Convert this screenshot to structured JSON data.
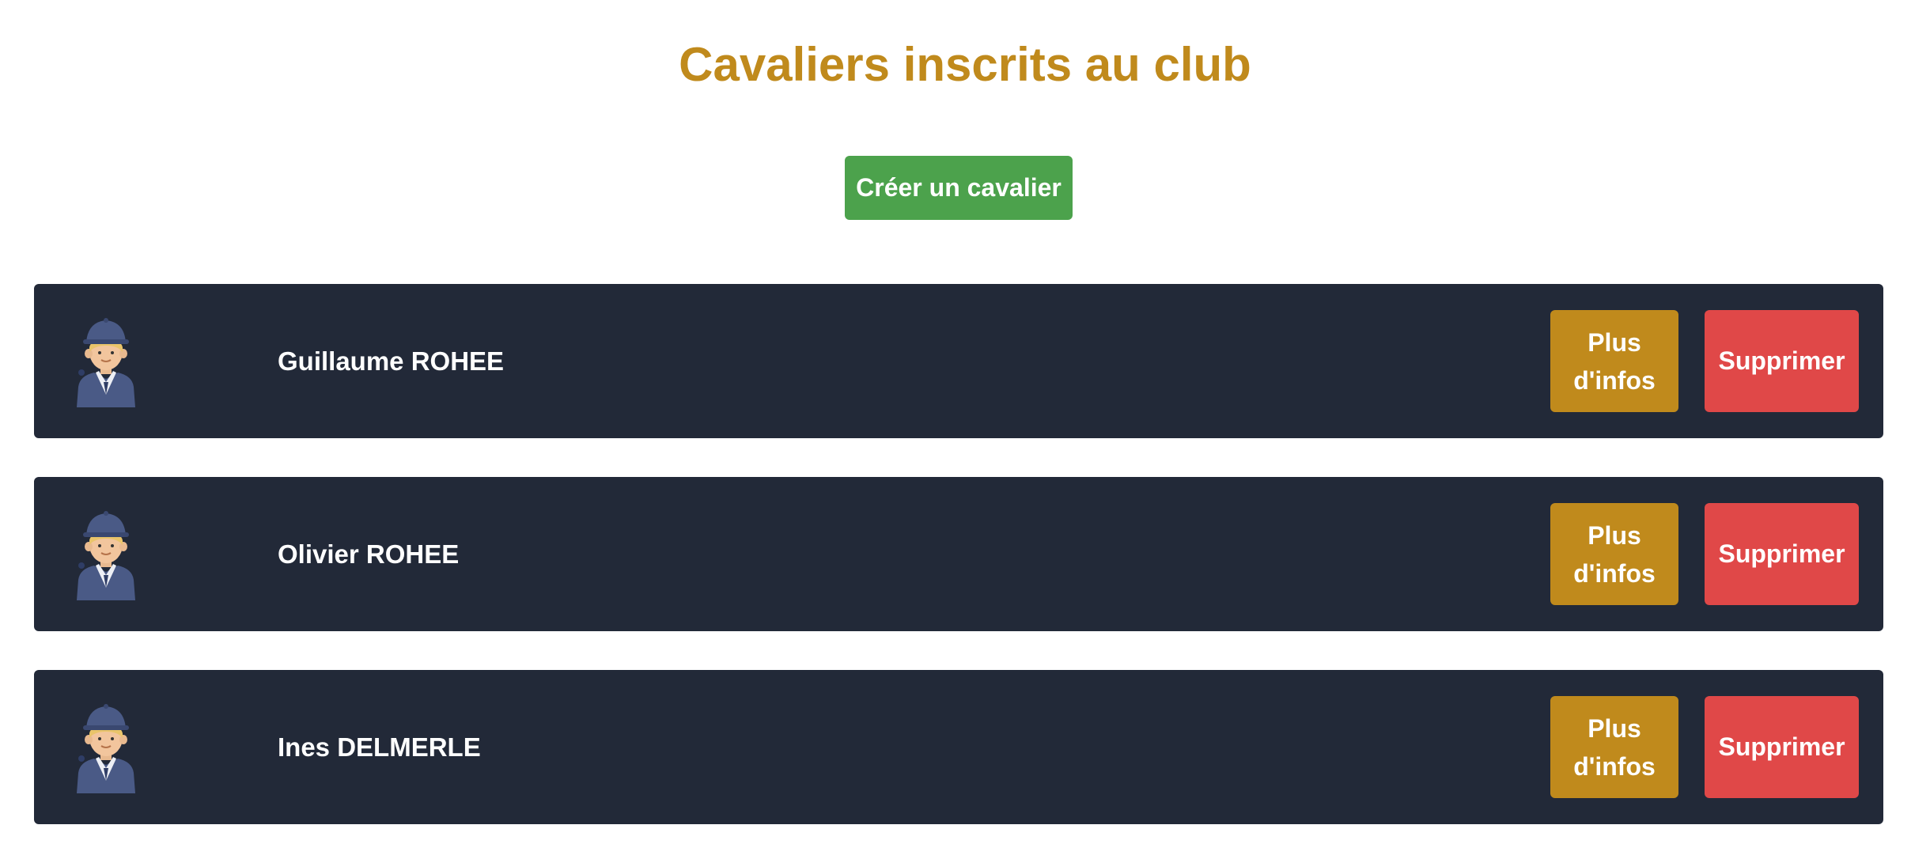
{
  "page": {
    "title": "Cavaliers inscrits au club",
    "create_button_label": "Créer un cavalier"
  },
  "colors": {
    "title": "#C08A1C",
    "create_button": "#4CA24C",
    "card_background": "#222938",
    "info_button": "#C08A1C",
    "delete_button": "#E04848"
  },
  "riders": [
    {
      "name": "Guillaume ROHEE",
      "avatar_icon": "rider-avatar-icon",
      "info_label": "Plus d'infos",
      "delete_label": "Supprimer"
    },
    {
      "name": "Olivier ROHEE",
      "avatar_icon": "rider-avatar-icon",
      "info_label": "Plus d'infos",
      "delete_label": "Supprimer"
    },
    {
      "name": "Ines DELMERLE",
      "avatar_icon": "rider-avatar-icon",
      "info_label": "Plus d'infos",
      "delete_label": "Supprimer"
    }
  ]
}
